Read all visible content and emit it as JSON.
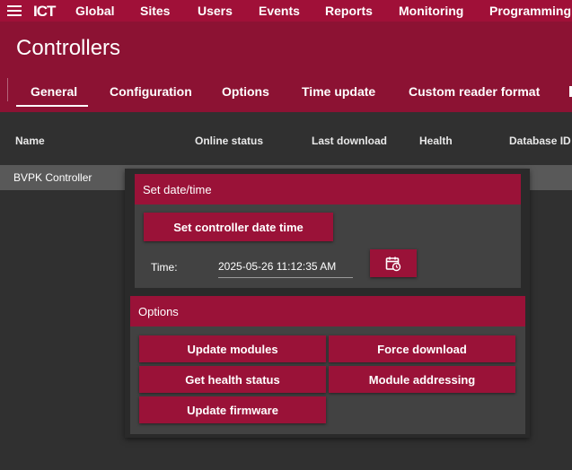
{
  "nav": {
    "logo": "ICT",
    "items": [
      "Global",
      "Sites",
      "Users",
      "Events",
      "Reports",
      "Monitoring",
      "Programming"
    ]
  },
  "header": {
    "title": "Controllers",
    "tabs": [
      "General",
      "Configuration",
      "Options",
      "Time update",
      "Custom reader format"
    ]
  },
  "table": {
    "columns": [
      "Name",
      "Online status",
      "Last download",
      "Health",
      "Database ID"
    ],
    "rows": [
      {
        "name": "BVPK Controller"
      }
    ]
  },
  "dialog": {
    "datetime": {
      "title": "Set date/time",
      "set_button": "Set controller date time",
      "time_label": "Time:",
      "time_value": "2025-05-26 11:12:35 AM",
      "picker_icon": "calendar-clock-icon"
    },
    "options": {
      "title": "Options",
      "buttons": [
        "Update modules",
        "Force download",
        "Get health status",
        "Module addressing",
        "Update firmware"
      ]
    }
  },
  "colors": {
    "accent": "#a01038",
    "header": "#8c1233",
    "background": "#303030"
  }
}
